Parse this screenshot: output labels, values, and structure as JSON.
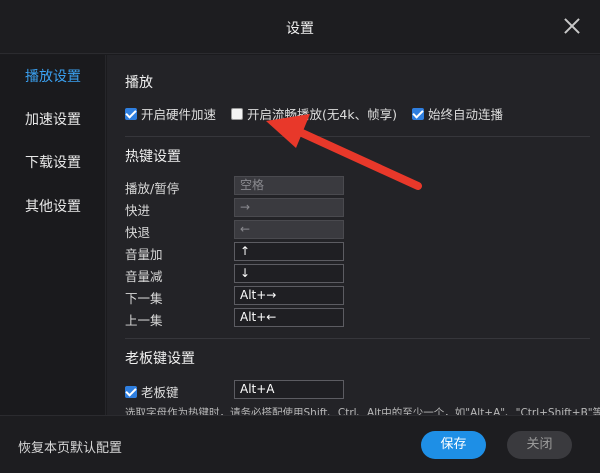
{
  "window": {
    "title": "设置"
  },
  "sidebar": {
    "items": [
      {
        "label": "播放设置",
        "active": true
      },
      {
        "label": "加速设置",
        "active": false
      },
      {
        "label": "下载设置",
        "active": false
      },
      {
        "label": "其他设置",
        "active": false
      }
    ]
  },
  "playback": {
    "title": "播放",
    "options": [
      {
        "label": "开启硬件加速",
        "checked": true
      },
      {
        "label": "开启流畅播放(无4k、帧享)",
        "checked": false
      },
      {
        "label": "始终自动连播",
        "checked": true
      }
    ]
  },
  "hotkeys": {
    "title": "热键设置",
    "rows": [
      {
        "label": "播放/暂停",
        "value": "空格"
      },
      {
        "label": "快进",
        "value": "→"
      },
      {
        "label": "快退",
        "value": "←"
      },
      {
        "label": "音量加",
        "value": "↑"
      },
      {
        "label": "音量减",
        "value": "↓"
      },
      {
        "label": "下一集",
        "value": "Alt+→"
      },
      {
        "label": "上一集",
        "value": "Alt+←"
      }
    ]
  },
  "boss_key": {
    "title": "老板键设置",
    "checkbox_label": "老板键",
    "checked": true,
    "value": "Alt+A",
    "note": "选取字母作为热键时，请务必搭配使用Shift、Ctrl、Alt中的至少一个，如\"Alt+A\"、\"Ctrl+Shift+B\"等"
  },
  "footer": {
    "restore_label": "恢复本页默认配置",
    "save_label": "保存",
    "close_label": "关闭"
  },
  "colors": {
    "accent": "#1e8fe6",
    "active_nav": "#3aa0f0",
    "annotation_arrow": "#e8382a"
  }
}
